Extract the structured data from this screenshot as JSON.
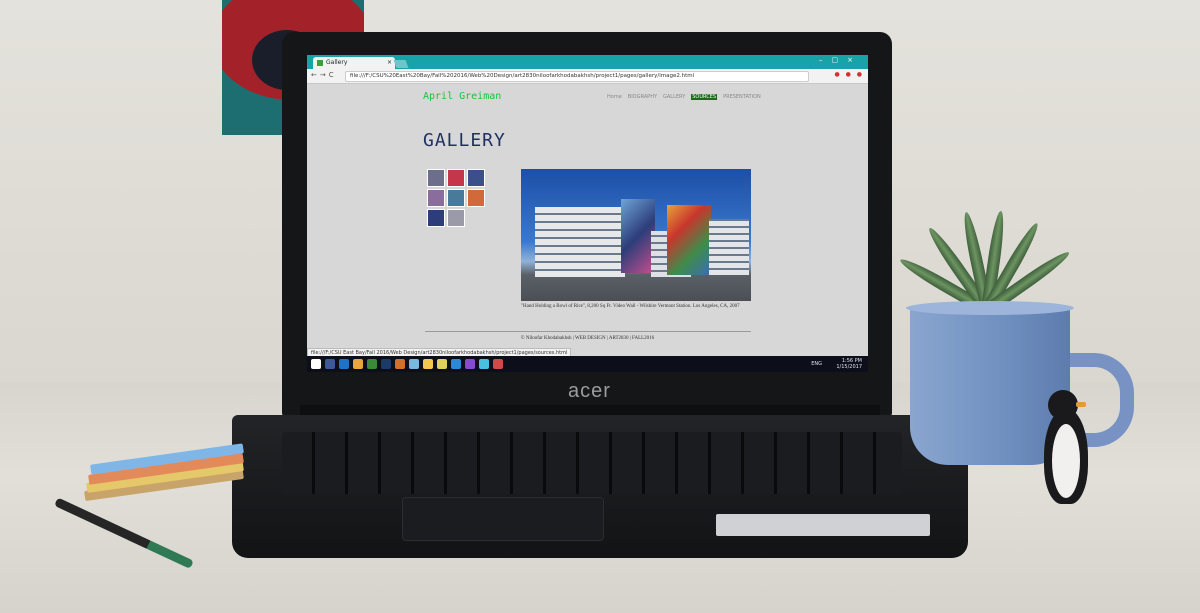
{
  "browser": {
    "tab_title": "Gallery",
    "tab_close": "×",
    "window_controls": "–▢×",
    "nav_buttons": "←→C",
    "url": "file:///F:/CSU%20East%20Bay/Fall%202016/Web%20Design/art2830niloofarkhodabakhsh/project1/pages/gallery/image2.html",
    "status_url": "file:///F:/CSU East Bay/Fall 2016/Web Design/art2830niloofarkhodabakhsh/project1/pages/sources.html"
  },
  "site": {
    "brand": "April Greiman",
    "nav": [
      {
        "label": "Home",
        "active": false
      },
      {
        "label": "BIOGRAPHY",
        "active": false
      },
      {
        "label": "GALLERY",
        "active": false
      },
      {
        "label": "SOURCES",
        "active": true
      },
      {
        "label": "PRESENTATION",
        "active": false
      }
    ],
    "heading": "GALLERY",
    "thumbnail_colors": [
      "#6d6e8c",
      "#c6364a",
      "#3b4f8a",
      "#8a6d9c",
      "#4a7a9a",
      "#d06a3a",
      "#2c3d7a",
      "#9a9aa8"
    ],
    "caption": "\"Hand Holding a Bowl of Rice\", 8,200 Sq Ft. Video Wall - Wilshire Vermont Station. Los Angeles, CA, 2007",
    "footer": "© Niloofar Khodabakhsh | WEB DESIGN | ART2830 | FALL2016"
  },
  "taskbar": {
    "icon_colors": [
      "#ffffff",
      "#3c5a99",
      "#1e73c8",
      "#e8a73a",
      "#3a8a3a",
      "#1a3a6a",
      "#d0702a",
      "#7ab8e0",
      "#f2c94c",
      "#e0d060",
      "#2a8ad8",
      "#8a4ad0",
      "#4ac0e0",
      "#d04a4a"
    ],
    "language": "ENG",
    "time": "1:56 PM",
    "date": "1/15/2017"
  },
  "hardware": {
    "logo": "acer"
  }
}
